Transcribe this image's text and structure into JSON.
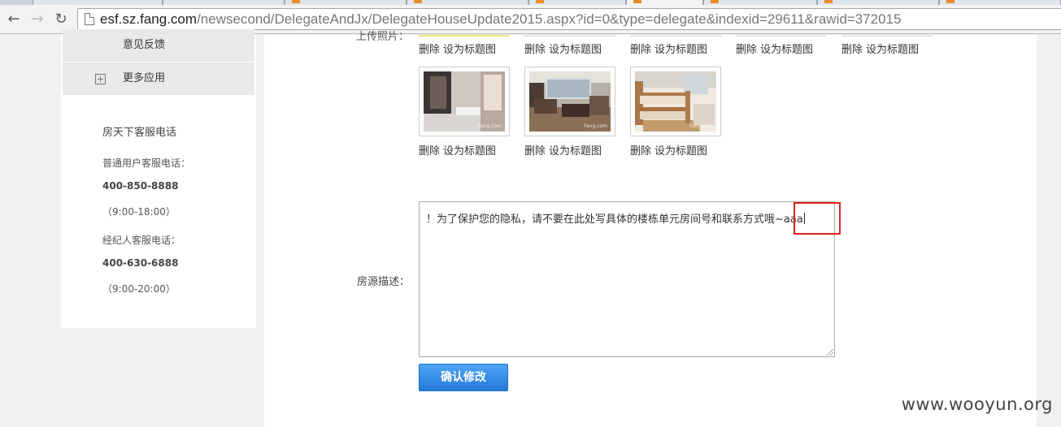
{
  "browser": {
    "url_host": "esf.sz.fang.com",
    "url_path": "/newsecond/DelegateAndJx/DelegateHouseUpdate2015.aspx?id=0&type=delegate&indexid=29611&rawid=372015"
  },
  "sidebar": {
    "menu": [
      {
        "label": "意见反馈"
      },
      {
        "label": "更多应用",
        "icon": "plus-box-icon"
      }
    ],
    "service": {
      "title": "房天下客服电话",
      "normal_label": "普通用户客服电话：",
      "normal_phone": "400-850-8888",
      "normal_hours": "（9:00-18:00）",
      "agent_label": "经纪人客服电话：",
      "agent_phone": "400-630-6888",
      "agent_hours": "（9:00-20:00）"
    }
  },
  "form": {
    "upload_label": "上传照片：",
    "photo_actions": {
      "delete": "删除",
      "set_cover": "设为标题图"
    },
    "watermark_logo": "Fang.com",
    "description_label": "房源描述：",
    "description_value": "！为了保护您的隐私，请不要在此处写具体的楼栋单元房间号和联系方式哦~aaa",
    "confirm_label": "确认修改"
  },
  "colors": {
    "highlight": "#e02020",
    "button": "#2a80dd"
  },
  "site_watermark": "www.wooyun.org"
}
